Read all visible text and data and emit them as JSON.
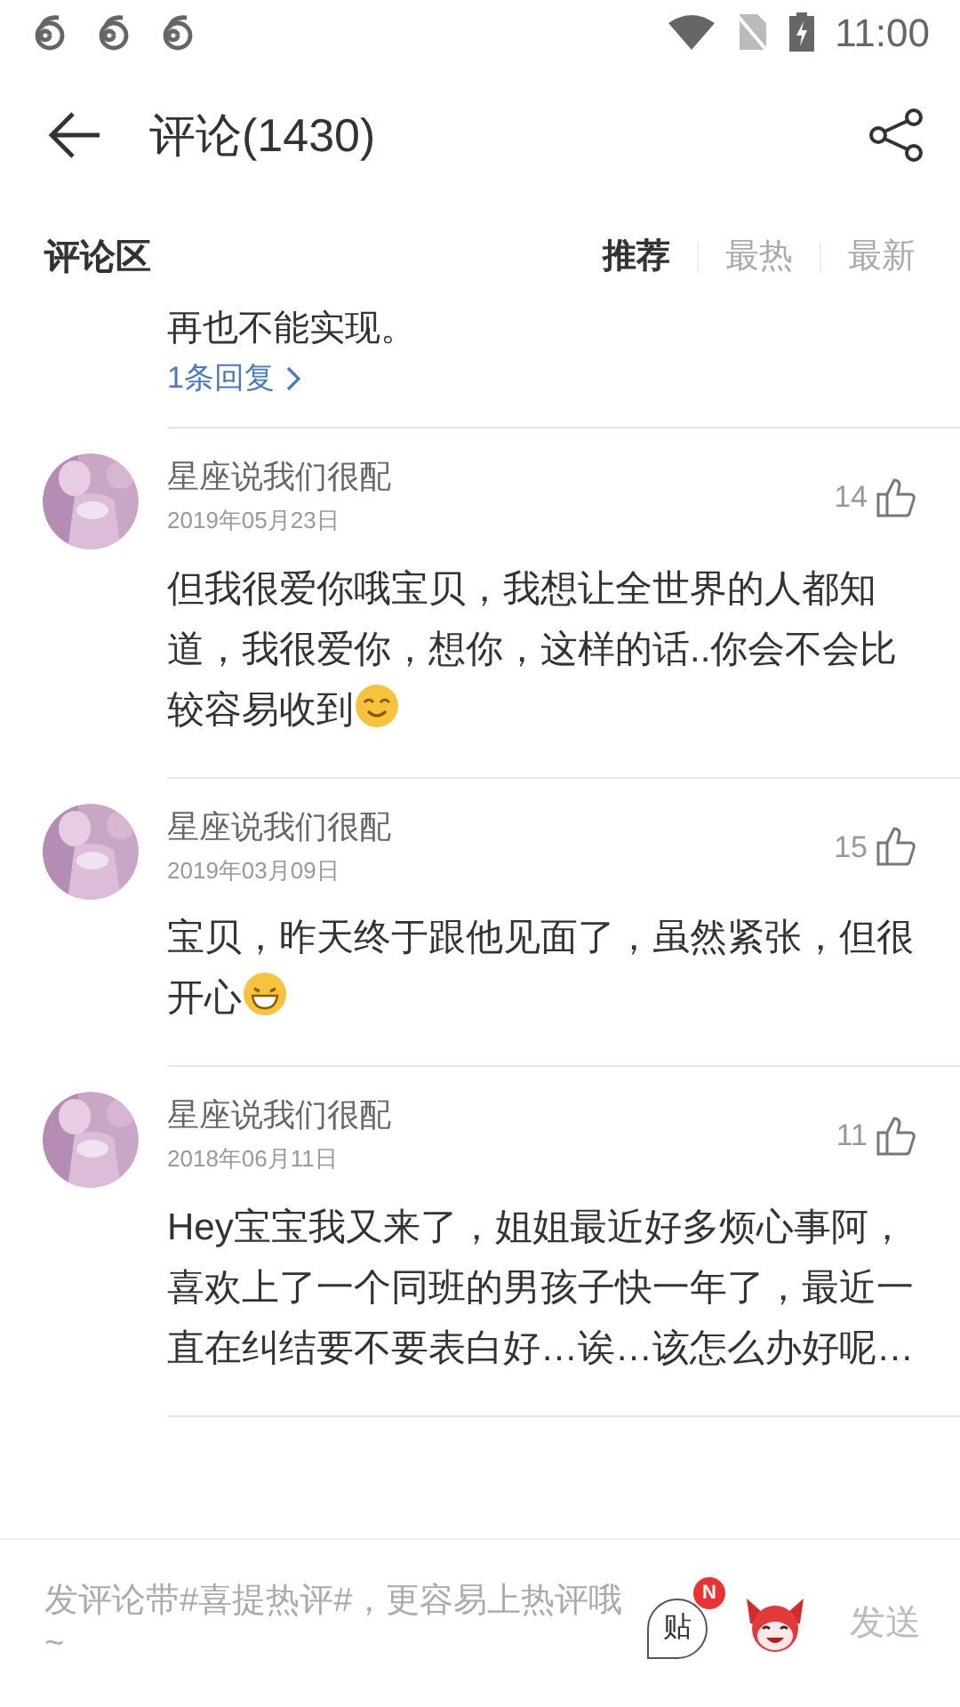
{
  "status_bar": {
    "time": "11:00"
  },
  "header": {
    "title": "评论(1430)"
  },
  "section": {
    "title": "评论区",
    "tabs": [
      {
        "label": "推荐",
        "selected": true
      },
      {
        "label": "最热",
        "selected": false
      },
      {
        "label": "最新",
        "selected": false
      }
    ]
  },
  "prev_comment": {
    "text": "再也不能实现。",
    "replies": "1条回复"
  },
  "comments": [
    {
      "user": "星座说我们很配",
      "date": "2019年05月23日",
      "likes": "14",
      "text": "但我很爱你哦宝贝，我想让全世界的人都知道，我很爱你，想你，这样的话..你会不会比较容易收到",
      "emoji": {
        "kind": "smile"
      }
    },
    {
      "user": "星座说我们很配",
      "date": "2019年03月09日",
      "likes": "15",
      "text": "宝贝，昨天终于跟他见面了，虽然紧张，但很开心",
      "emoji": {
        "kind": "grin"
      }
    },
    {
      "user": "星座说我们很配",
      "date": "2018年06月11日",
      "likes": "11",
      "text": "Hey宝宝我又来了，姐姐最近好多烦心事阿，喜欢上了一个同班的男孩子快一年了，最近一直在纠结要不要表白好…诶…该怎么办好呢…"
    }
  ],
  "composer": {
    "placeholder": "发评论带#喜提热评#，更容易上热评哦~",
    "sticker_label": "贴",
    "badge": "N",
    "send": "发送"
  }
}
